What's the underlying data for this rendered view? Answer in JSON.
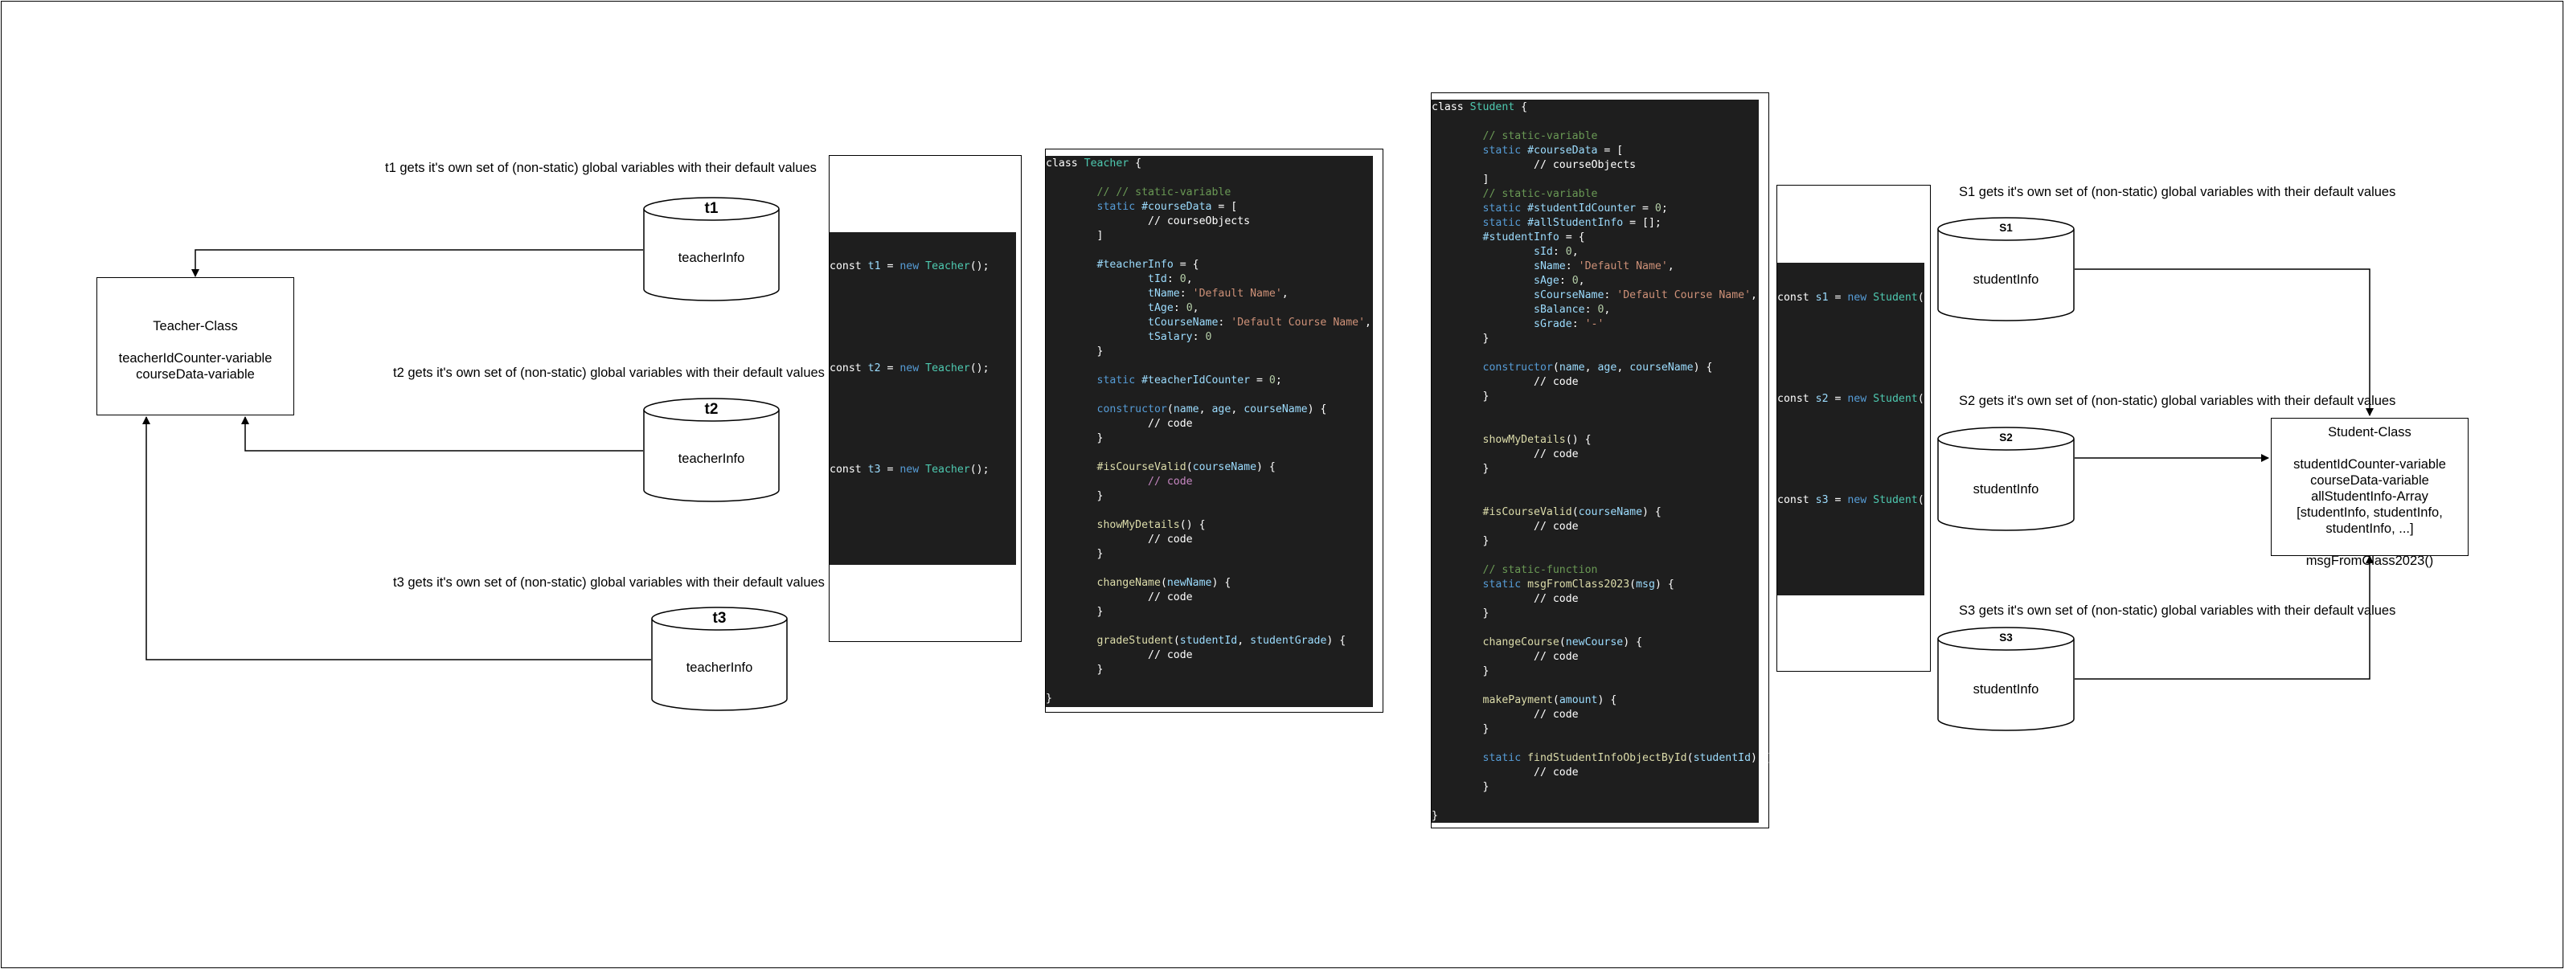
{
  "teacher_side": {
    "class_box": {
      "title": "Teacher-Class",
      "line1": "teacherIdCounter-variable",
      "line2": "courseData-variable"
    },
    "instances": [
      {
        "name": "t1",
        "content": "teacherInfo",
        "caption": "t1 gets it's own set of (non-static) global variables with their default values"
      },
      {
        "name": "t2",
        "content": "teacherInfo",
        "caption": "t2 gets it's own set of (non-static) global variables with their default values"
      },
      {
        "name": "t3",
        "content": "teacherInfo",
        "caption": "t3 gets it's own set of (non-static) global variables with their default values"
      }
    ],
    "instantiation_code": [
      "t1",
      "t2",
      "t3"
    ]
  },
  "student_side": {
    "class_box": {
      "title": "Student-Class",
      "line1": "studentIdCounter-variable",
      "line2": "courseData-variable",
      "line3": "allStudentInfo-Array",
      "line4": "[studentInfo, studentInfo,",
      "line5": "studentInfo, ...]",
      "line6": "msgFromClass2023()"
    },
    "instances": [
      {
        "name": "S1",
        "content": "studentInfo",
        "caption": "S1 gets it's own set of (non-static) global variables with their default values"
      },
      {
        "name": "S2",
        "content": "studentInfo",
        "caption": "S2 gets it's own set of (non-static) global variables with their default values"
      },
      {
        "name": "S3",
        "content": "studentInfo",
        "caption": "S3 gets it's own set of (non-static) global variables with their default values"
      }
    ],
    "instantiation_code": [
      "s1",
      "s2",
      "s3"
    ]
  },
  "code": {
    "teacher_class_name": "Teacher",
    "student_class_name": "Student"
  },
  "colors": {
    "code_bg": "#1e1e1e",
    "keyword": "#569cd6",
    "class": "#4ec9b0",
    "variable": "#9cdcfe",
    "string": "#ce9178",
    "number": "#b5cea8",
    "function": "#dcdcaa",
    "comment": "#6a9955"
  }
}
